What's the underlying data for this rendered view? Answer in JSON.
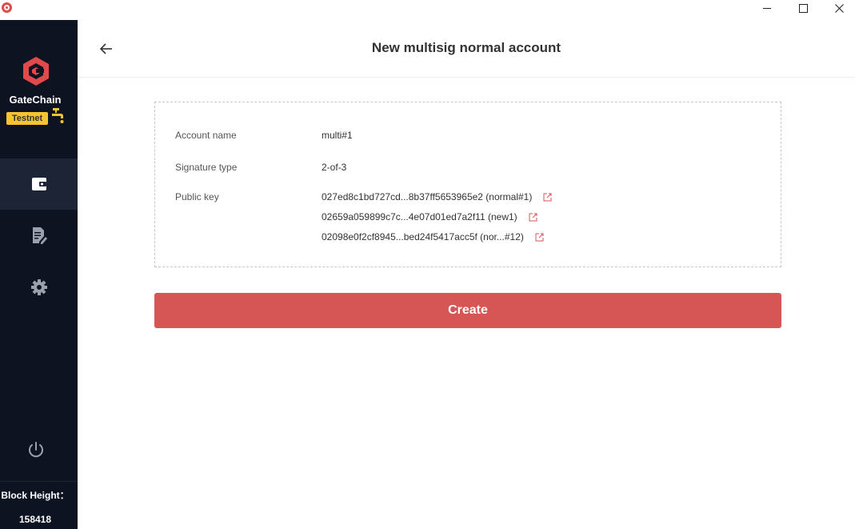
{
  "window": {
    "icons": {
      "app": "app-logo-icon",
      "minimize": "minimize-icon",
      "maximize": "maximize-icon",
      "close": "close-icon"
    }
  },
  "sidebar": {
    "brand": "GateChain",
    "network_badge": "Testnet",
    "nav": [
      {
        "icon": "wallet-icon",
        "active": true
      },
      {
        "icon": "document-edit-icon",
        "active": false
      },
      {
        "icon": "gear-icon",
        "active": false
      }
    ],
    "power_icon": "power-icon",
    "block_height_label": "Block Height：",
    "block_height_value": "158418",
    "colors": {
      "background": "#0e1322",
      "active": "#1d2436",
      "brand": "#e04a4a",
      "badge": "#f5c530"
    }
  },
  "header": {
    "title": "New multisig normal account",
    "back_icon": "arrow-left-icon"
  },
  "details": {
    "account_name_label": "Account name",
    "account_name_value": "multi#1",
    "signature_type_label": "Signature type",
    "signature_type_value": "2-of-3",
    "public_key_label": "Public key",
    "public_keys": [
      "027ed8c1bd727cd...8b37ff5653965e2 (normal#1)",
      "02659a059899c7c...4e07d01ed7a2f11 (new1)",
      "02098e0f2cf8945...bed24f5417acc5f (nor...#12)"
    ],
    "edit_icon": "external-link-icon"
  },
  "actions": {
    "create_label": "Create",
    "create_color": "#d65656"
  }
}
